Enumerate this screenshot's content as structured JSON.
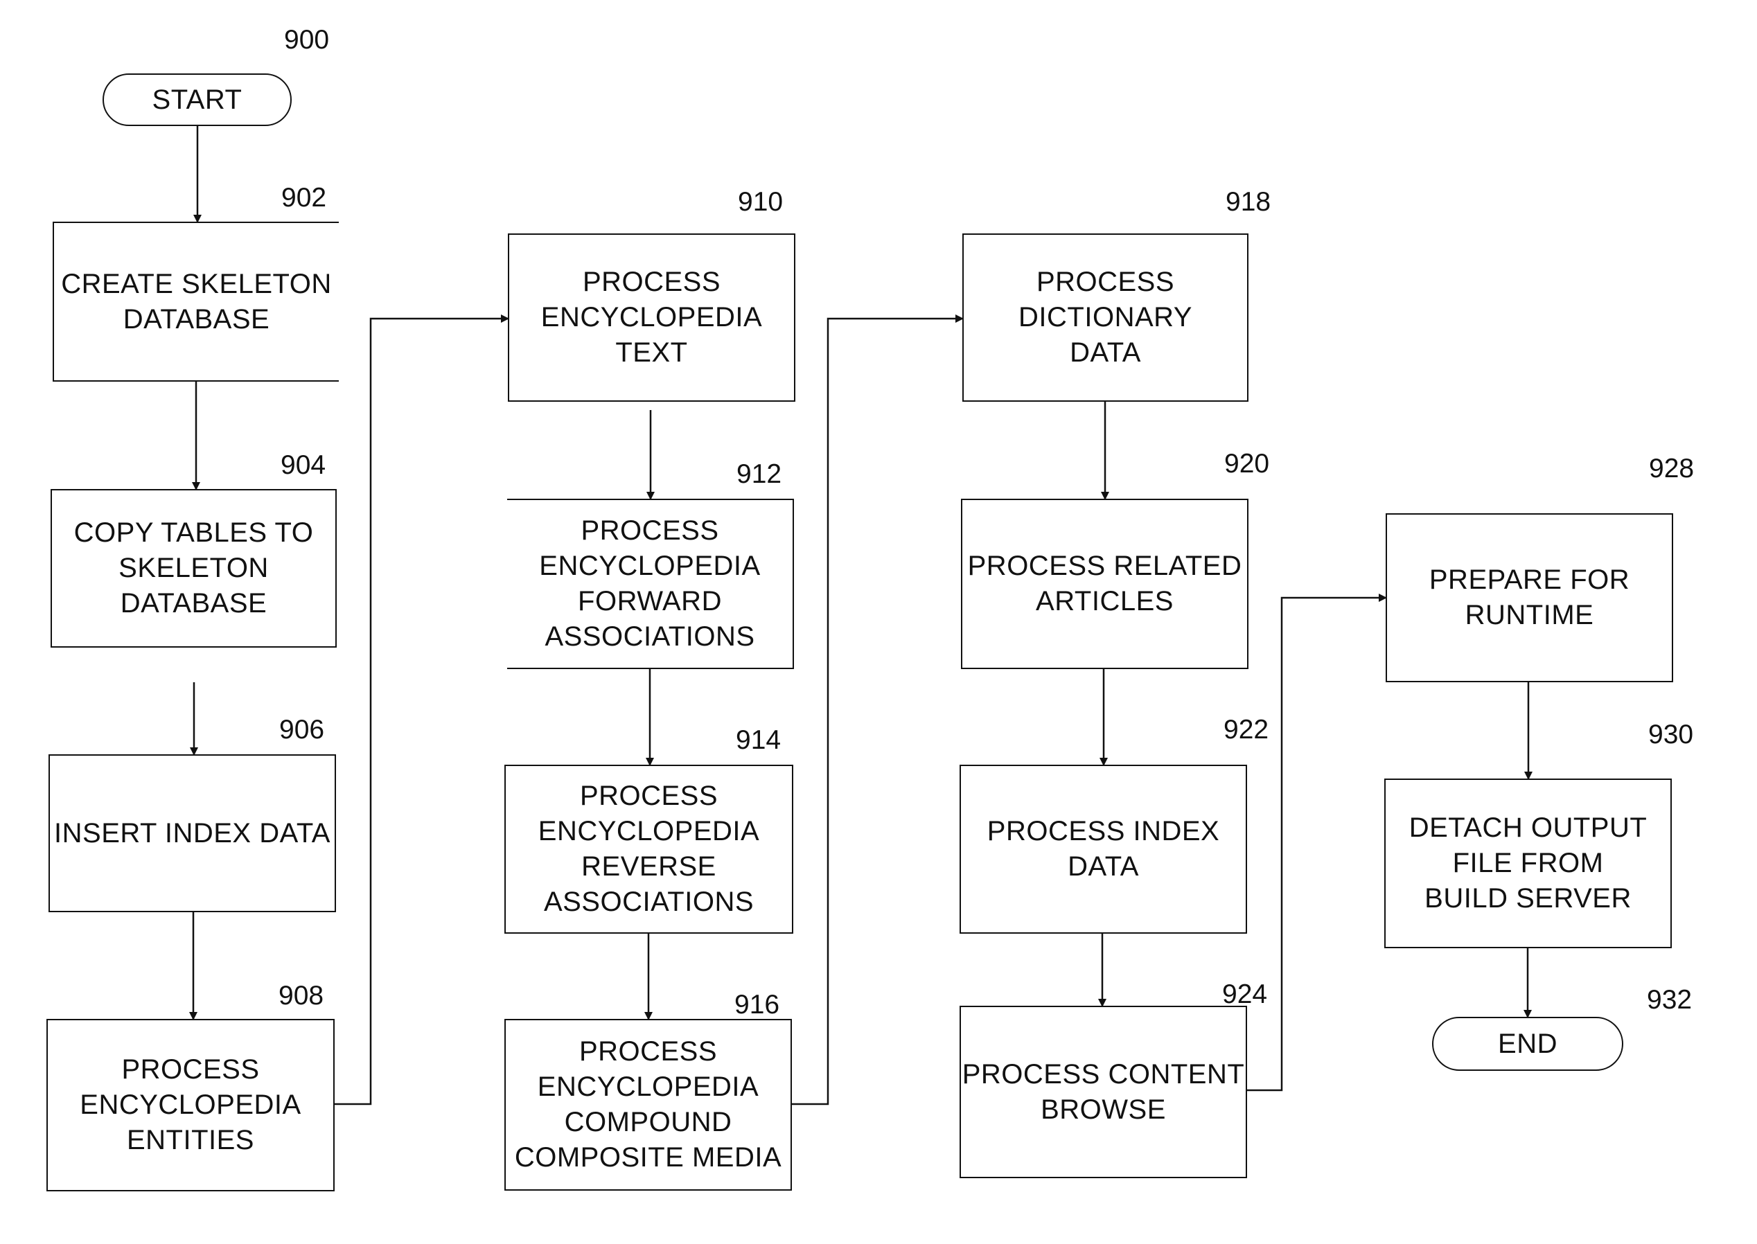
{
  "figure": {
    "type": "flowchart",
    "figure_number": "900"
  },
  "nodes": [
    {
      "id": "900",
      "ref": "900",
      "kind": "terminal",
      "label": "START"
    },
    {
      "id": "902",
      "ref": "902",
      "kind": "process",
      "label": "CREATE SKELETON\nDATABASE"
    },
    {
      "id": "904",
      "ref": "904",
      "kind": "process",
      "label": "COPY TABLES TO\nSKELETON\nDATABASE"
    },
    {
      "id": "906",
      "ref": "906",
      "kind": "process",
      "label": "INSERT INDEX DATA"
    },
    {
      "id": "908",
      "ref": "908",
      "kind": "process",
      "label": "PROCESS\nENCYCLOPEDIA\nENTITIES"
    },
    {
      "id": "910",
      "ref": "910",
      "kind": "process",
      "label": "PROCESS\nENCYCLOPEDIA\nTEXT"
    },
    {
      "id": "912",
      "ref": "912",
      "kind": "process",
      "label": "PROCESS\nENCYCLOPEDIA\nFORWARD\nASSOCIATIONS"
    },
    {
      "id": "914",
      "ref": "914",
      "kind": "process",
      "label": "PROCESS\nENCYCLOPEDIA\nREVERSE\nASSOCIATIONS"
    },
    {
      "id": "916",
      "ref": "916",
      "kind": "process",
      "label": "PROCESS\nENCYCLOPEDIA\nCOMPOUND\nCOMPOSITE MEDIA"
    },
    {
      "id": "918",
      "ref": "918",
      "kind": "process",
      "label": "PROCESS\nDICTIONARY\nDATA"
    },
    {
      "id": "920",
      "ref": "920",
      "kind": "process",
      "label": "PROCESS RELATED\nARTICLES"
    },
    {
      "id": "922",
      "ref": "922",
      "kind": "process",
      "label": "PROCESS INDEX\nDATA"
    },
    {
      "id": "924",
      "ref": "924",
      "kind": "process",
      "label": "PROCESS CONTENT\nBROWSE"
    },
    {
      "id": "928",
      "ref": "928",
      "kind": "process",
      "label": "PREPARE FOR\nRUNTIME"
    },
    {
      "id": "930",
      "ref": "930",
      "kind": "process",
      "label": "DETACH OUTPUT\nFILE FROM\nBUILD SERVER"
    },
    {
      "id": "932",
      "ref": "932",
      "kind": "terminal",
      "label": "END"
    }
  ],
  "edges": [
    {
      "from": "900",
      "to": "902"
    },
    {
      "from": "902",
      "to": "904"
    },
    {
      "from": "904",
      "to": "906"
    },
    {
      "from": "906",
      "to": "908"
    },
    {
      "from": "908",
      "to": "910"
    },
    {
      "from": "910",
      "to": "912"
    },
    {
      "from": "912",
      "to": "914"
    },
    {
      "from": "914",
      "to": "916"
    },
    {
      "from": "916",
      "to": "918"
    },
    {
      "from": "918",
      "to": "920"
    },
    {
      "from": "920",
      "to": "922"
    },
    {
      "from": "922",
      "to": "924"
    },
    {
      "from": "924",
      "to": "928"
    },
    {
      "from": "928",
      "to": "930"
    },
    {
      "from": "930",
      "to": "932"
    }
  ],
  "colors": {
    "ink": "#111111",
    "background": "#ffffff"
  }
}
